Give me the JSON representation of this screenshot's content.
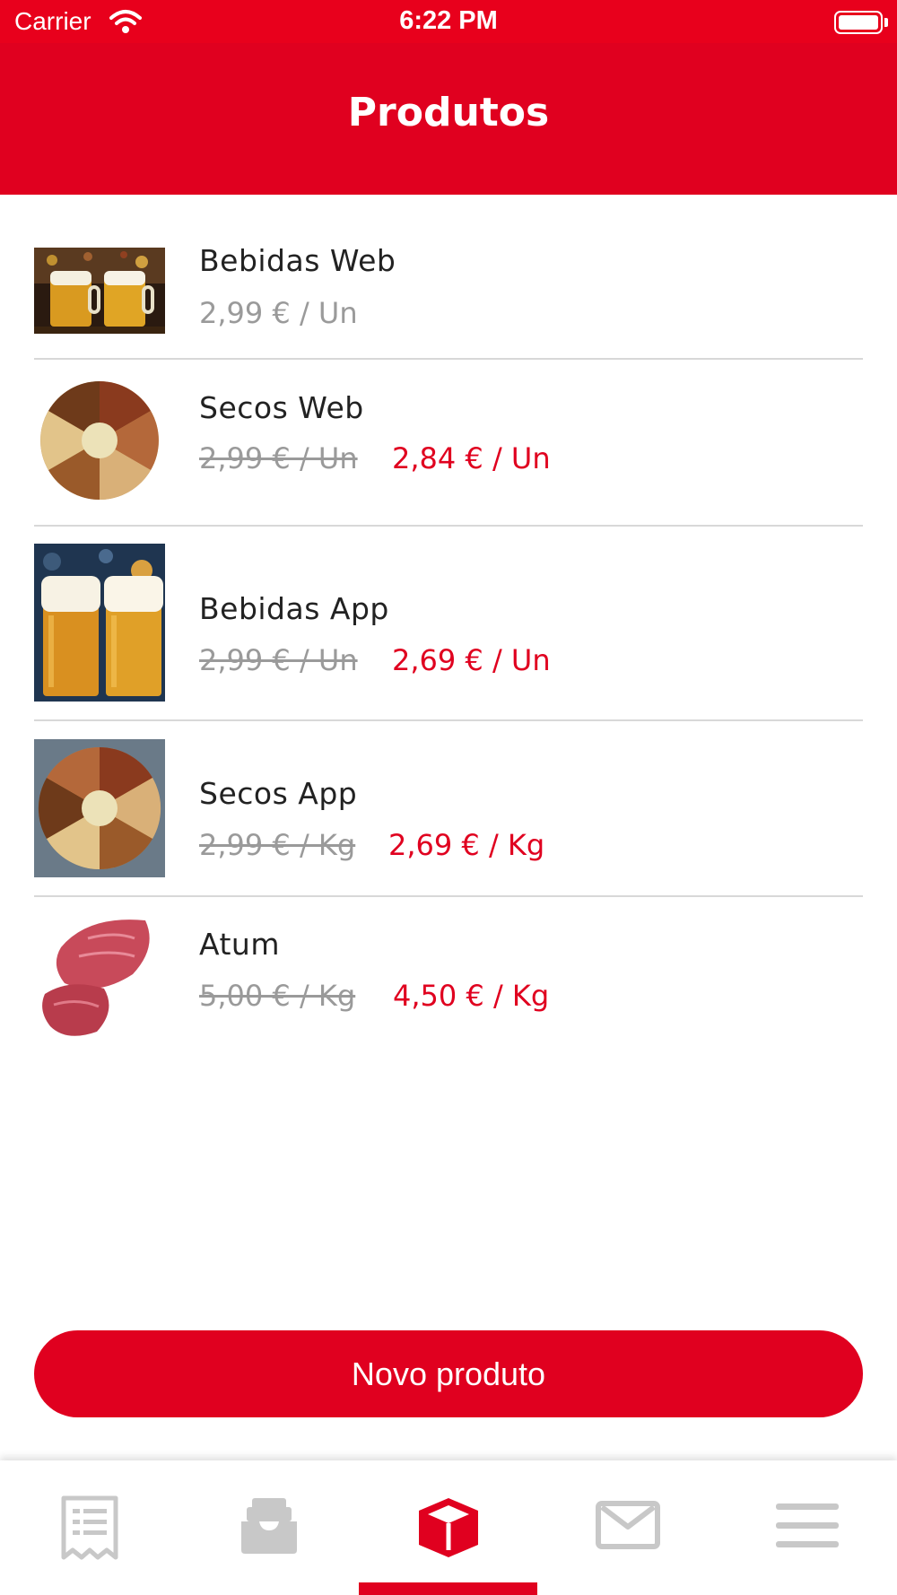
{
  "status": {
    "carrier": "Carrier",
    "time": "6:22 PM"
  },
  "nav": {
    "title": "Produtos"
  },
  "products": [
    {
      "name": "Bebidas Web",
      "price": "2,99 € / Un",
      "discounted_price": ""
    },
    {
      "name": "Secos Web",
      "price": "2,99 € / Un",
      "discounted_price": "2,84 € / Un"
    },
    {
      "name": "Bebidas App",
      "price": "2,99 € / Un",
      "discounted_price": "2,69 € / Un"
    },
    {
      "name": "Secos App",
      "price": "2,99 € / Kg",
      "discounted_price": "2,69 € / Kg"
    },
    {
      "name": "Atum",
      "price": "5,00 € / Kg",
      "discounted_price": "4,50 € / Kg"
    }
  ],
  "actions": {
    "new_product_label": "Novo produto"
  },
  "tabs": [
    {
      "icon": "receipt-icon",
      "active": false
    },
    {
      "icon": "inbox-tray-icon",
      "active": false
    },
    {
      "icon": "package-box-icon",
      "active": true
    },
    {
      "icon": "envelope-icon",
      "active": false
    },
    {
      "icon": "menu-icon",
      "active": false
    }
  ],
  "colors": {
    "brand": "#e0001f",
    "inactive_icon": "#c8c8c8",
    "strikethrough_price": "#9a9a9a"
  }
}
